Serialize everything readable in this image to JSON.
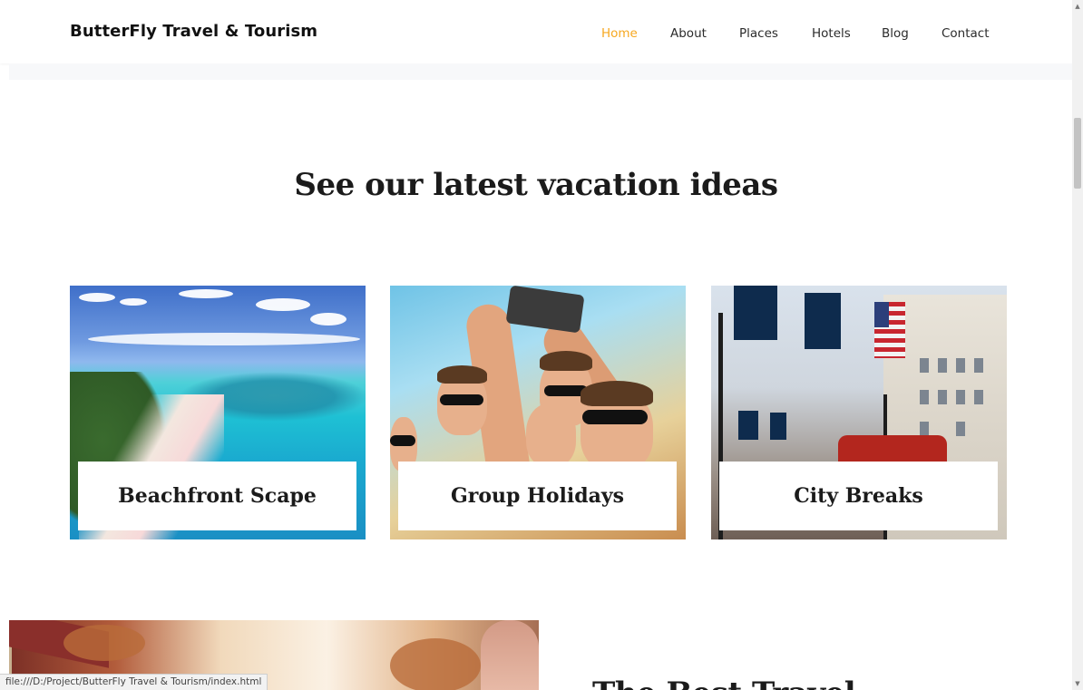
{
  "header": {
    "brand": "ButterFly Travel & Tourism",
    "nav": [
      {
        "label": "Home",
        "active": true
      },
      {
        "label": "About",
        "active": false
      },
      {
        "label": "Places",
        "active": false
      },
      {
        "label": "Hotels",
        "active": false
      },
      {
        "label": "Blog",
        "active": false
      },
      {
        "label": "Contact",
        "active": false
      }
    ],
    "active_color": "#f6a820"
  },
  "section": {
    "title": "See our latest vacation ideas",
    "cards": [
      {
        "label": "Beachfront Scape",
        "image": "beach-aerial-image"
      },
      {
        "label": "Group Holidays",
        "image": "group-selfie-image"
      },
      {
        "label": "City Breaks",
        "image": "city-street-image"
      }
    ]
  },
  "bottom": {
    "heading_partial": "The Best Travel"
  },
  "status_bar": {
    "url": "file:///D:/Project/ButterFly Travel & Tourism/index.html"
  },
  "scrollbar": {
    "up_icon": "scroll-up-arrow-icon",
    "down_icon": "scroll-down-arrow-icon"
  }
}
